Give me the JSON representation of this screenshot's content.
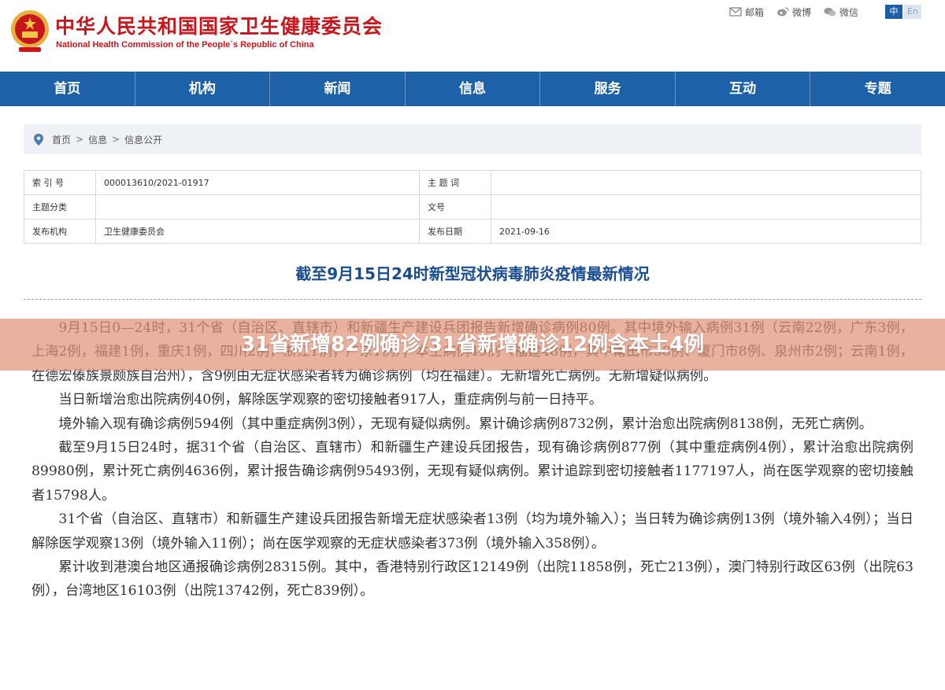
{
  "header": {
    "title": "中华人民共和国国家卫生健康委员会",
    "subtitle": "National Health Commission of the People´s Republic of China",
    "links": [
      {
        "label": "邮箱",
        "icon": "mail-icon"
      },
      {
        "label": "微博",
        "icon": "weibo-icon"
      },
      {
        "label": "微信",
        "icon": "wechat-icon"
      }
    ],
    "lang": {
      "zh": "中",
      "en": "En"
    }
  },
  "nav": [
    "首页",
    "机构",
    "新闻",
    "信息",
    "服务",
    "互动",
    "专题"
  ],
  "breadcrumb": {
    "icon": "location-pin-icon",
    "items": [
      "首页",
      "信息",
      "信息公开"
    ]
  },
  "meta": {
    "rows": [
      {
        "k1": "索 引 号",
        "v1": "000013610/2021-01917",
        "k2": "主 题 词",
        "v2": ""
      },
      {
        "k1": "主题分类",
        "v1": "",
        "k2": "文号",
        "v2": ""
      },
      {
        "k1": "发布机构",
        "v1": "卫生健康委员会",
        "k2": "发布日期",
        "v2": "2021-09-16"
      }
    ]
  },
  "article": {
    "title": "截至9月15日24时新型冠状病毒肺炎疫情最新情况",
    "paragraphs": [
      "9月15日0—24时，31个省（自治区、直辖市）和新疆生产建设兵团报告新增确诊病例80例。其中境外输入病例31例（云南22例，广东3例，上海2例，福建1例，重庆1例，四川2例，浙江1例，广东1例）；本土病例49例（福建48例，其中莆田市38例、厦门市8例、泉州市2例；云南1例，在德宏傣族景颇族自治州），含9例由无症状感染者转为确诊病例（均在福建）。无新增死亡病例。无新增疑似病例。",
      "当日新增治愈出院病例40例，解除医学观察的密切接触者917人，重症病例与前一日持平。",
      "境外输入现有确诊病例594例（其中重症病例3例），无现有疑似病例。累计确诊病例8732例，累计治愈出院病例8138例，无死亡病例。",
      "截至9月15日24时，据31个省（自治区、直辖市）和新疆生产建设兵团报告，现有确诊病例877例（其中重症病例4例），累计治愈出院病例89980例，累计死亡病例4636例，累计报告确诊病例95493例，无现有疑似病例。累计追踪到密切接触者1177197人，尚在医学观察的密切接触者15798人。",
      "31个省（自治区、直辖市）和新疆生产建设兵团报告新增无症状感染者13例（均为境外输入）；当日转为确诊病例13例（境外输入4例）；当日解除医学观察13例（境外输入11例）；尚在医学观察的无症状感染者373例（境外输入358例）。",
      "累计收到港澳台地区通报确诊病例28315例。其中，香港特别行政区12149例（出院11858例，死亡213例），澳门特别行政区63例（出院63例），台湾地区16103例（出院13742例，死亡839例）。"
    ]
  },
  "banner": {
    "text": "31省新增82例确诊/31省新增确诊12例含本土4例"
  },
  "colors": {
    "brand_red": "#c8161d",
    "nav_blue": "#1d61a8",
    "title_blue": "#1a4d8f",
    "banner": "#e19478"
  }
}
